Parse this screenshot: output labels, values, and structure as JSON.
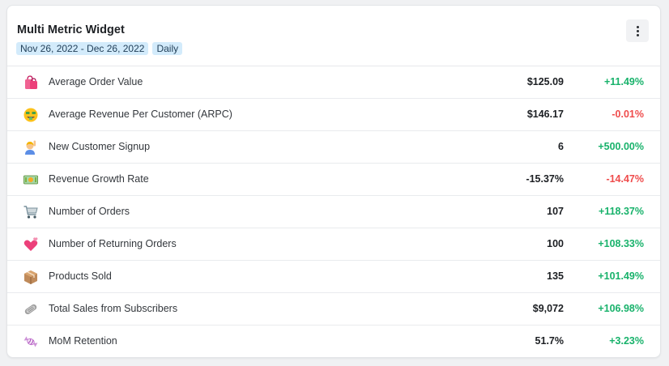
{
  "widget": {
    "title": "Multi Metric Widget",
    "date_range": "Nov 26, 2022 - Dec 26, 2022",
    "granularity": "Daily",
    "menu_icon": "more-vertical-icon"
  },
  "colors": {
    "positive": "#18b26b",
    "negative": "#ef4c4c",
    "chip_bg": "#d3ebfb"
  },
  "metrics": [
    {
      "icon": "shopping-bags-icon",
      "label": "Average Order Value",
      "value": "$125.09",
      "change": "+11.49%",
      "trend": "positive"
    },
    {
      "icon": "money-mouth-face-icon",
      "label": "Average Revenue Per Customer (ARPC)",
      "value": "$146.17",
      "change": "-0.01%",
      "trend": "negative"
    },
    {
      "icon": "person-raising-hand-icon",
      "label": "New Customer Signup",
      "value": "6",
      "change": "+500.00%",
      "trend": "positive"
    },
    {
      "icon": "dollar-banknote-icon",
      "label": "Revenue Growth Rate",
      "value": "-15.37%",
      "change": "-14.47%",
      "trend": "negative"
    },
    {
      "icon": "shopping-cart-icon",
      "label": "Number of Orders",
      "value": "107",
      "change": "+118.37%",
      "trend": "positive"
    },
    {
      "icon": "revolving-hearts-icon",
      "label": "Number of Returning Orders",
      "value": "100",
      "change": "+108.33%",
      "trend": "positive"
    },
    {
      "icon": "package-icon",
      "label": "Products Sold",
      "value": "135",
      "change": "+101.49%",
      "trend": "positive"
    },
    {
      "icon": "rolled-newspaper-icon",
      "label": "Total Sales from Subscribers",
      "value": "$9,072",
      "change": "+106.98%",
      "trend": "positive"
    },
    {
      "icon": "candy-icon",
      "label": "MoM Retention",
      "value": "51.7%",
      "change": "+3.23%",
      "trend": "positive"
    }
  ]
}
